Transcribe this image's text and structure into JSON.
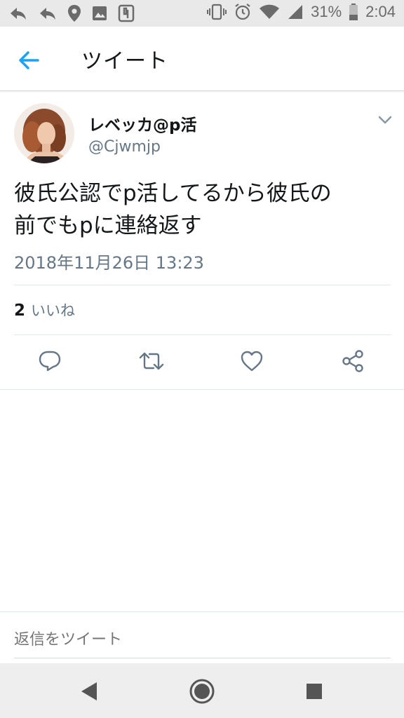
{
  "status_bar": {
    "battery": "31%",
    "time": "2:04"
  },
  "app_bar": {
    "title": "ツイート"
  },
  "tweet": {
    "display_name": "レベッカ@p活",
    "handle": "@Cjwmjp",
    "text_line1": "彼氏公認でp活してるから彼氏の",
    "text_line2": "前でもpに連絡返す",
    "timestamp": "2018年11月26日 13:23",
    "likes_count": "2",
    "likes_label": "いいね"
  },
  "reply": {
    "placeholder": "返信をツイート"
  },
  "colors": {
    "accent": "#1da1f2",
    "text": "#14171a",
    "muted": "#657786",
    "divider": "#e1e8ed"
  },
  "icons": {
    "back": "arrow-left-icon",
    "caret": "chevron-down-icon",
    "reply": "reply-icon",
    "retweet": "retweet-icon",
    "like": "heart-icon",
    "share": "share-icon"
  }
}
